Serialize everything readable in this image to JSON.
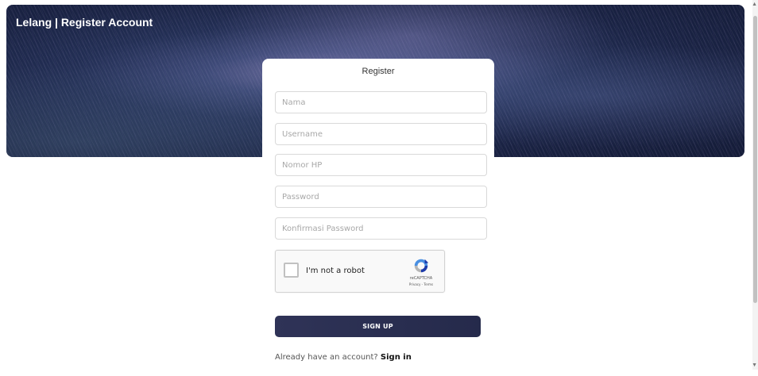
{
  "header": {
    "title": "Lelang | Register Account"
  },
  "form": {
    "title": "Register",
    "fields": {
      "nama": {
        "placeholder": "Nama",
        "value": ""
      },
      "username": {
        "placeholder": "Username",
        "value": ""
      },
      "nomor_hp": {
        "placeholder": "Nomor HP",
        "value": ""
      },
      "password": {
        "placeholder": "Password",
        "value": ""
      },
      "konfirmasi_password": {
        "placeholder": "Konfirmasi Password",
        "value": ""
      }
    },
    "recaptcha": {
      "label": "I'm not a robot",
      "brand": "reCAPTCHA",
      "privacy": "Privacy",
      "separator": " - ",
      "terms": "Terms",
      "icon": "recaptcha-logo-icon"
    },
    "submit_label": "SIGN UP",
    "signin_prompt": "Already have an account? ",
    "signin_link": "Sign in"
  },
  "colors": {
    "button": "#2a2e50",
    "banner": "#1a2344",
    "card": "#ffffff"
  }
}
